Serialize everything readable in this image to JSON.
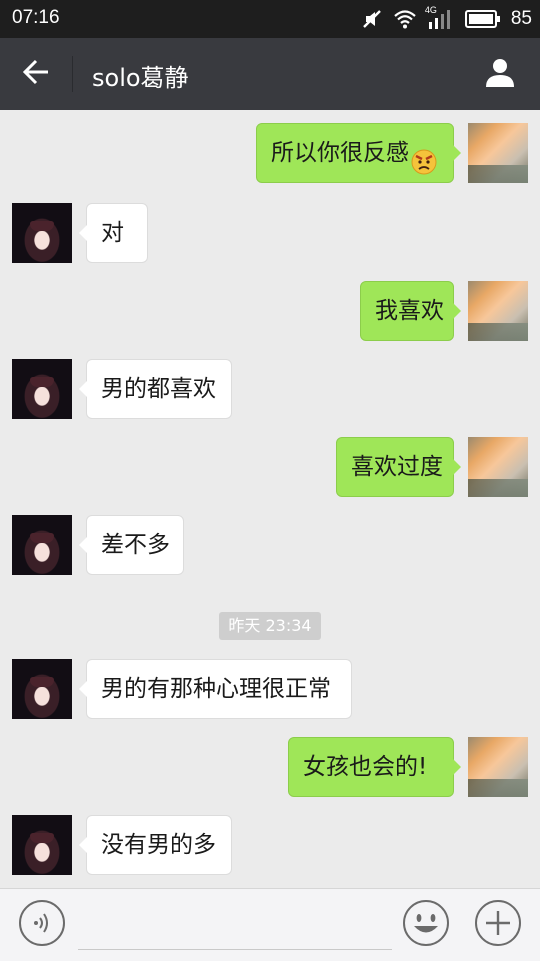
{
  "status_bar": {
    "time": "07:16",
    "network": "4G",
    "battery": "85",
    "icons": [
      "mute-icon",
      "wifi-icon",
      "signal-icon",
      "battery-icon"
    ]
  },
  "header": {
    "back_icon": "arrow-left-icon",
    "title": "solo葛静",
    "profile_icon": "person-icon"
  },
  "messages": [
    {
      "side": "right",
      "text": "所以你很反感",
      "emoji": "angry-face-emoji"
    },
    {
      "side": "left",
      "text": "对"
    },
    {
      "side": "right",
      "text": "我喜欢"
    },
    {
      "side": "left",
      "text": "男的都喜欢"
    },
    {
      "side": "right",
      "text": "喜欢过度"
    },
    {
      "side": "left",
      "text": "差不多"
    },
    {
      "side": "left",
      "text": "男的有那种心理很正常"
    },
    {
      "side": "right",
      "text": "女孩也会的!"
    },
    {
      "side": "left",
      "text": "没有男的多"
    }
  ],
  "timestamp": "昨天 23:34",
  "input_bar": {
    "voice_icon": "voice-icon",
    "input_value": "",
    "emoji_icon": "smiley-icon",
    "plus_icon": "plus-icon"
  },
  "colors": {
    "status_bar_bg": "#1e1e1e",
    "title_bar_bg": "#393a3f",
    "chat_bg": "#ebebeb",
    "bubble_self": "#9fe658",
    "bubble_other": "#ffffff"
  }
}
